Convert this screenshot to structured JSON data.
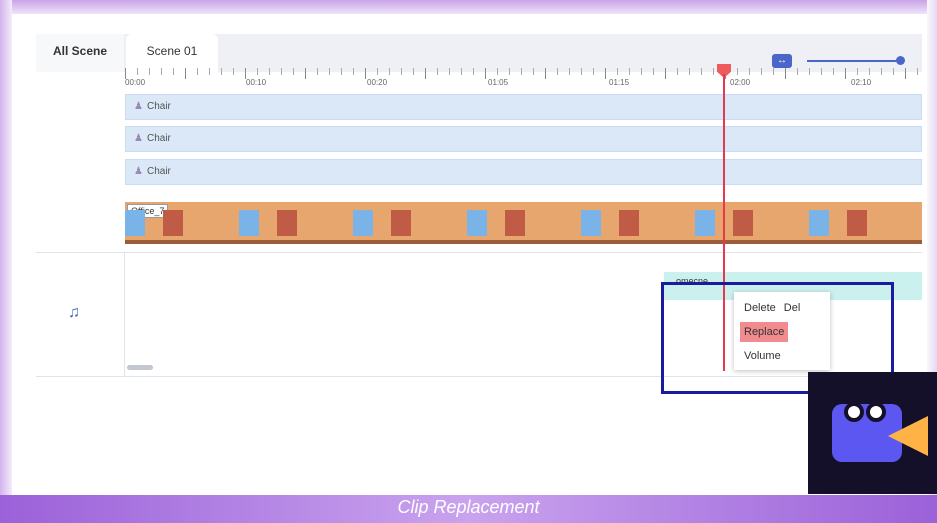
{
  "tabs": {
    "all_scene": "All Scene",
    "scene": "Scene 01"
  },
  "toolbar": {
    "zoom_icon": "fit-width-icon"
  },
  "ruler": {
    "times": [
      "00:00",
      "00:10",
      "00:20",
      "01:05",
      "01:15",
      "02:00",
      "02:10"
    ]
  },
  "tracks": [
    {
      "label": "Chair",
      "icon": "person-icon"
    },
    {
      "label": "Chair",
      "icon": "person-icon"
    },
    {
      "label": "Chair",
      "icon": "person-icon"
    }
  ],
  "scene_clip": {
    "label": "Office_7"
  },
  "audio": {
    "icon": "music-note-icon",
    "clip_label": "omecne"
  },
  "context_menu": {
    "delete_label": "Delete",
    "delete_shortcut": "Del",
    "replace_label": "Replace",
    "volume_label": "Volume"
  },
  "caption": "Clip Replacement",
  "colors": {
    "accent": "#4a66c8",
    "playhead": "#e8384d",
    "highlight": "#1b1ba0",
    "menu_selected": "#f18b8f"
  }
}
